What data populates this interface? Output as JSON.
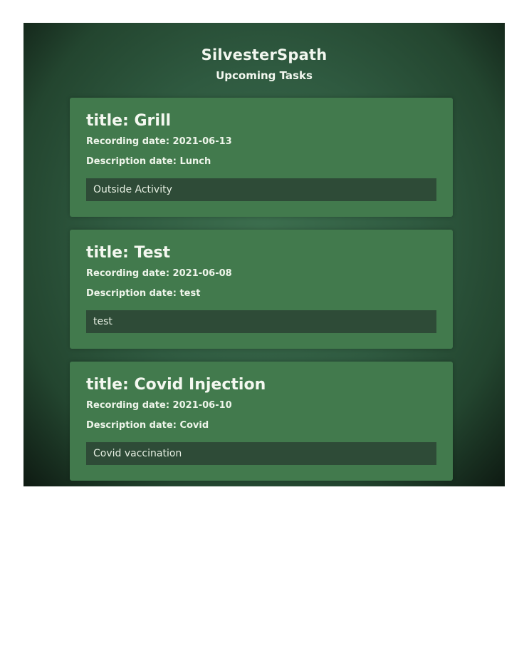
{
  "header": {
    "title": "SilvesterSpath",
    "subtitle": "Upcoming Tasks"
  },
  "labels": {
    "title_prefix": "title: ",
    "recording_prefix": "Recording date: ",
    "description_prefix": "Description date: "
  },
  "tasks": [
    {
      "title": "title: Grill",
      "recording": "Recording date: 2021-06-13",
      "description_date": "Description date: Lunch",
      "description": "Outside Activity"
    },
    {
      "title": "title: Test",
      "recording": "Recording date: 2021-06-08",
      "description_date": "Description date: test",
      "description": "test"
    },
    {
      "title": "title: Covid Injection",
      "recording": "Recording date: 2021-06-10",
      "description_date": "Description date: Covid",
      "description": "Covid vaccination"
    }
  ]
}
